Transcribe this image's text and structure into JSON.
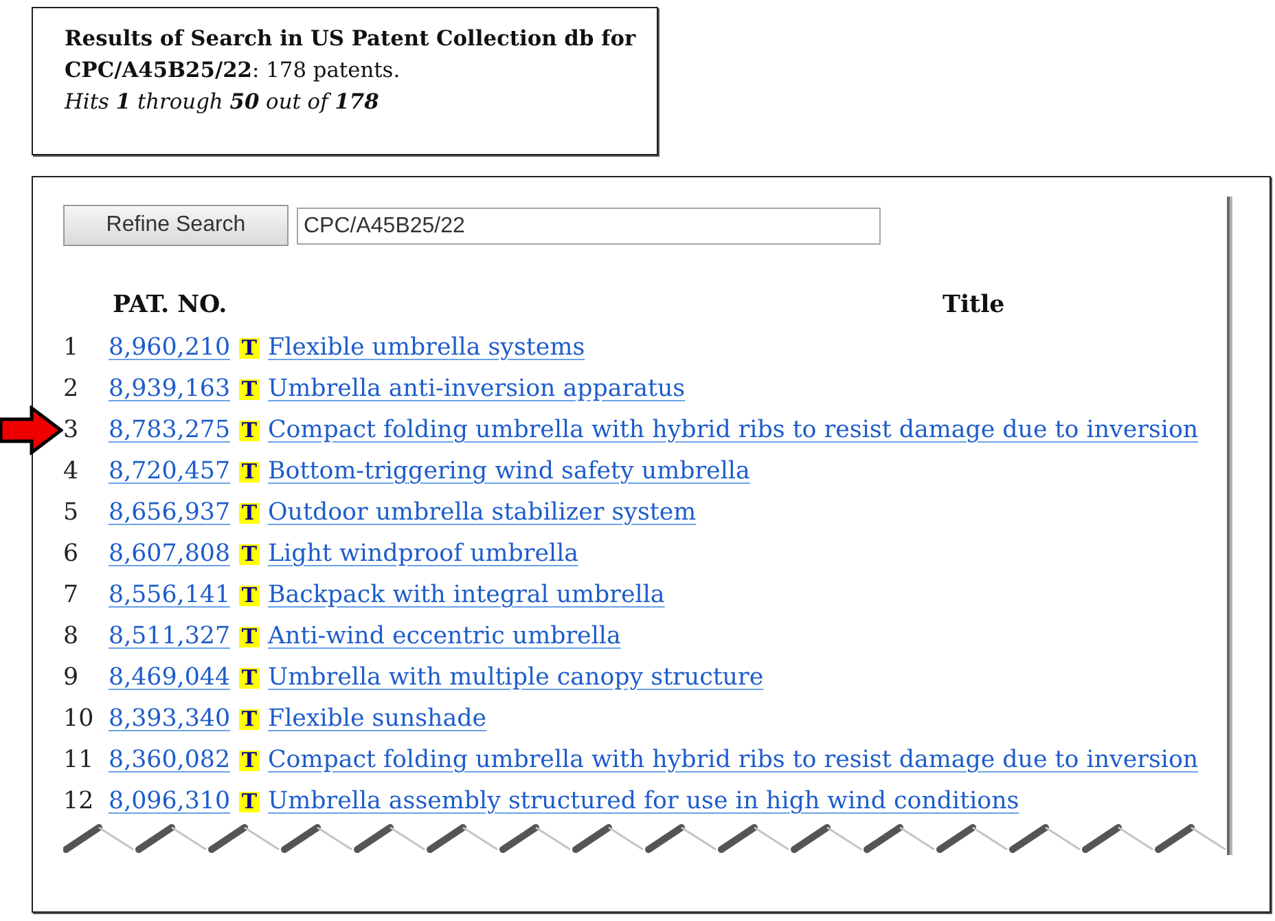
{
  "summary": {
    "heading": "**Results of Search in US Patent Collection db for CPC/A45B25/22**: 178 patents.",
    "hits": "Hits **1** through **50** out of **178**"
  },
  "search": {
    "button": "Refine Search",
    "value": "CPC/A45B25/22"
  },
  "table": {
    "columns": [
      {
        "label": "PAT. NO."
      },
      {
        "label": "Title"
      }
    ],
    "rows": [
      {
        "number": "1",
        "patent_no": "8,960,210",
        "text_link": "T",
        "title": "Flexible umbrella systems",
        "marked": false
      },
      {
        "number": "2",
        "patent_no": "8,939,163",
        "text_link": "T",
        "title": "Umbrella anti-inversion apparatus",
        "marked": false
      },
      {
        "number": "3",
        "patent_no": "8,783,275",
        "text_link": "T",
        "title": "Compact folding umbrella with hybrid ribs to resist damage due to inversion",
        "marked": true
      },
      {
        "number": "4",
        "patent_no": "8,720,457",
        "text_link": "T",
        "title": "Bottom-triggering wind safety umbrella",
        "marked": false
      },
      {
        "number": "5",
        "patent_no": "8,656,937",
        "text_link": "T",
        "title": "Outdoor umbrella stabilizer system",
        "marked": false
      },
      {
        "number": "6",
        "patent_no": "8,607,808",
        "text_link": "T",
        "title": "Light windproof umbrella",
        "marked": false
      },
      {
        "number": "7",
        "patent_no": "8,556,141",
        "text_link": "T",
        "title": "Backpack with integral umbrella",
        "marked": false
      },
      {
        "number": "8",
        "patent_no": "8,511,327",
        "text_link": "T",
        "title": "Anti-wind eccentric umbrella",
        "marked": false
      },
      {
        "number": "9",
        "patent_no": "8,469,044",
        "text_link": "T",
        "title": "Umbrella with multiple canopy structure",
        "marked": false
      },
      {
        "number": "10",
        "patent_no": "8,393,340",
        "text_link": "T",
        "title": "Flexible sunshade",
        "marked": false
      },
      {
        "number": "11",
        "patent_no": "8,360,082",
        "text_link": "T",
        "title": "Compact folding umbrella with hybrid ribs to resist damage due to inversion",
        "marked": false
      },
      {
        "number": "12",
        "patent_no": "8,096,310",
        "text_link": "T",
        "title": "Umbrella assembly structured for use in high wind conditions",
        "marked": false
      }
    ]
  }
}
